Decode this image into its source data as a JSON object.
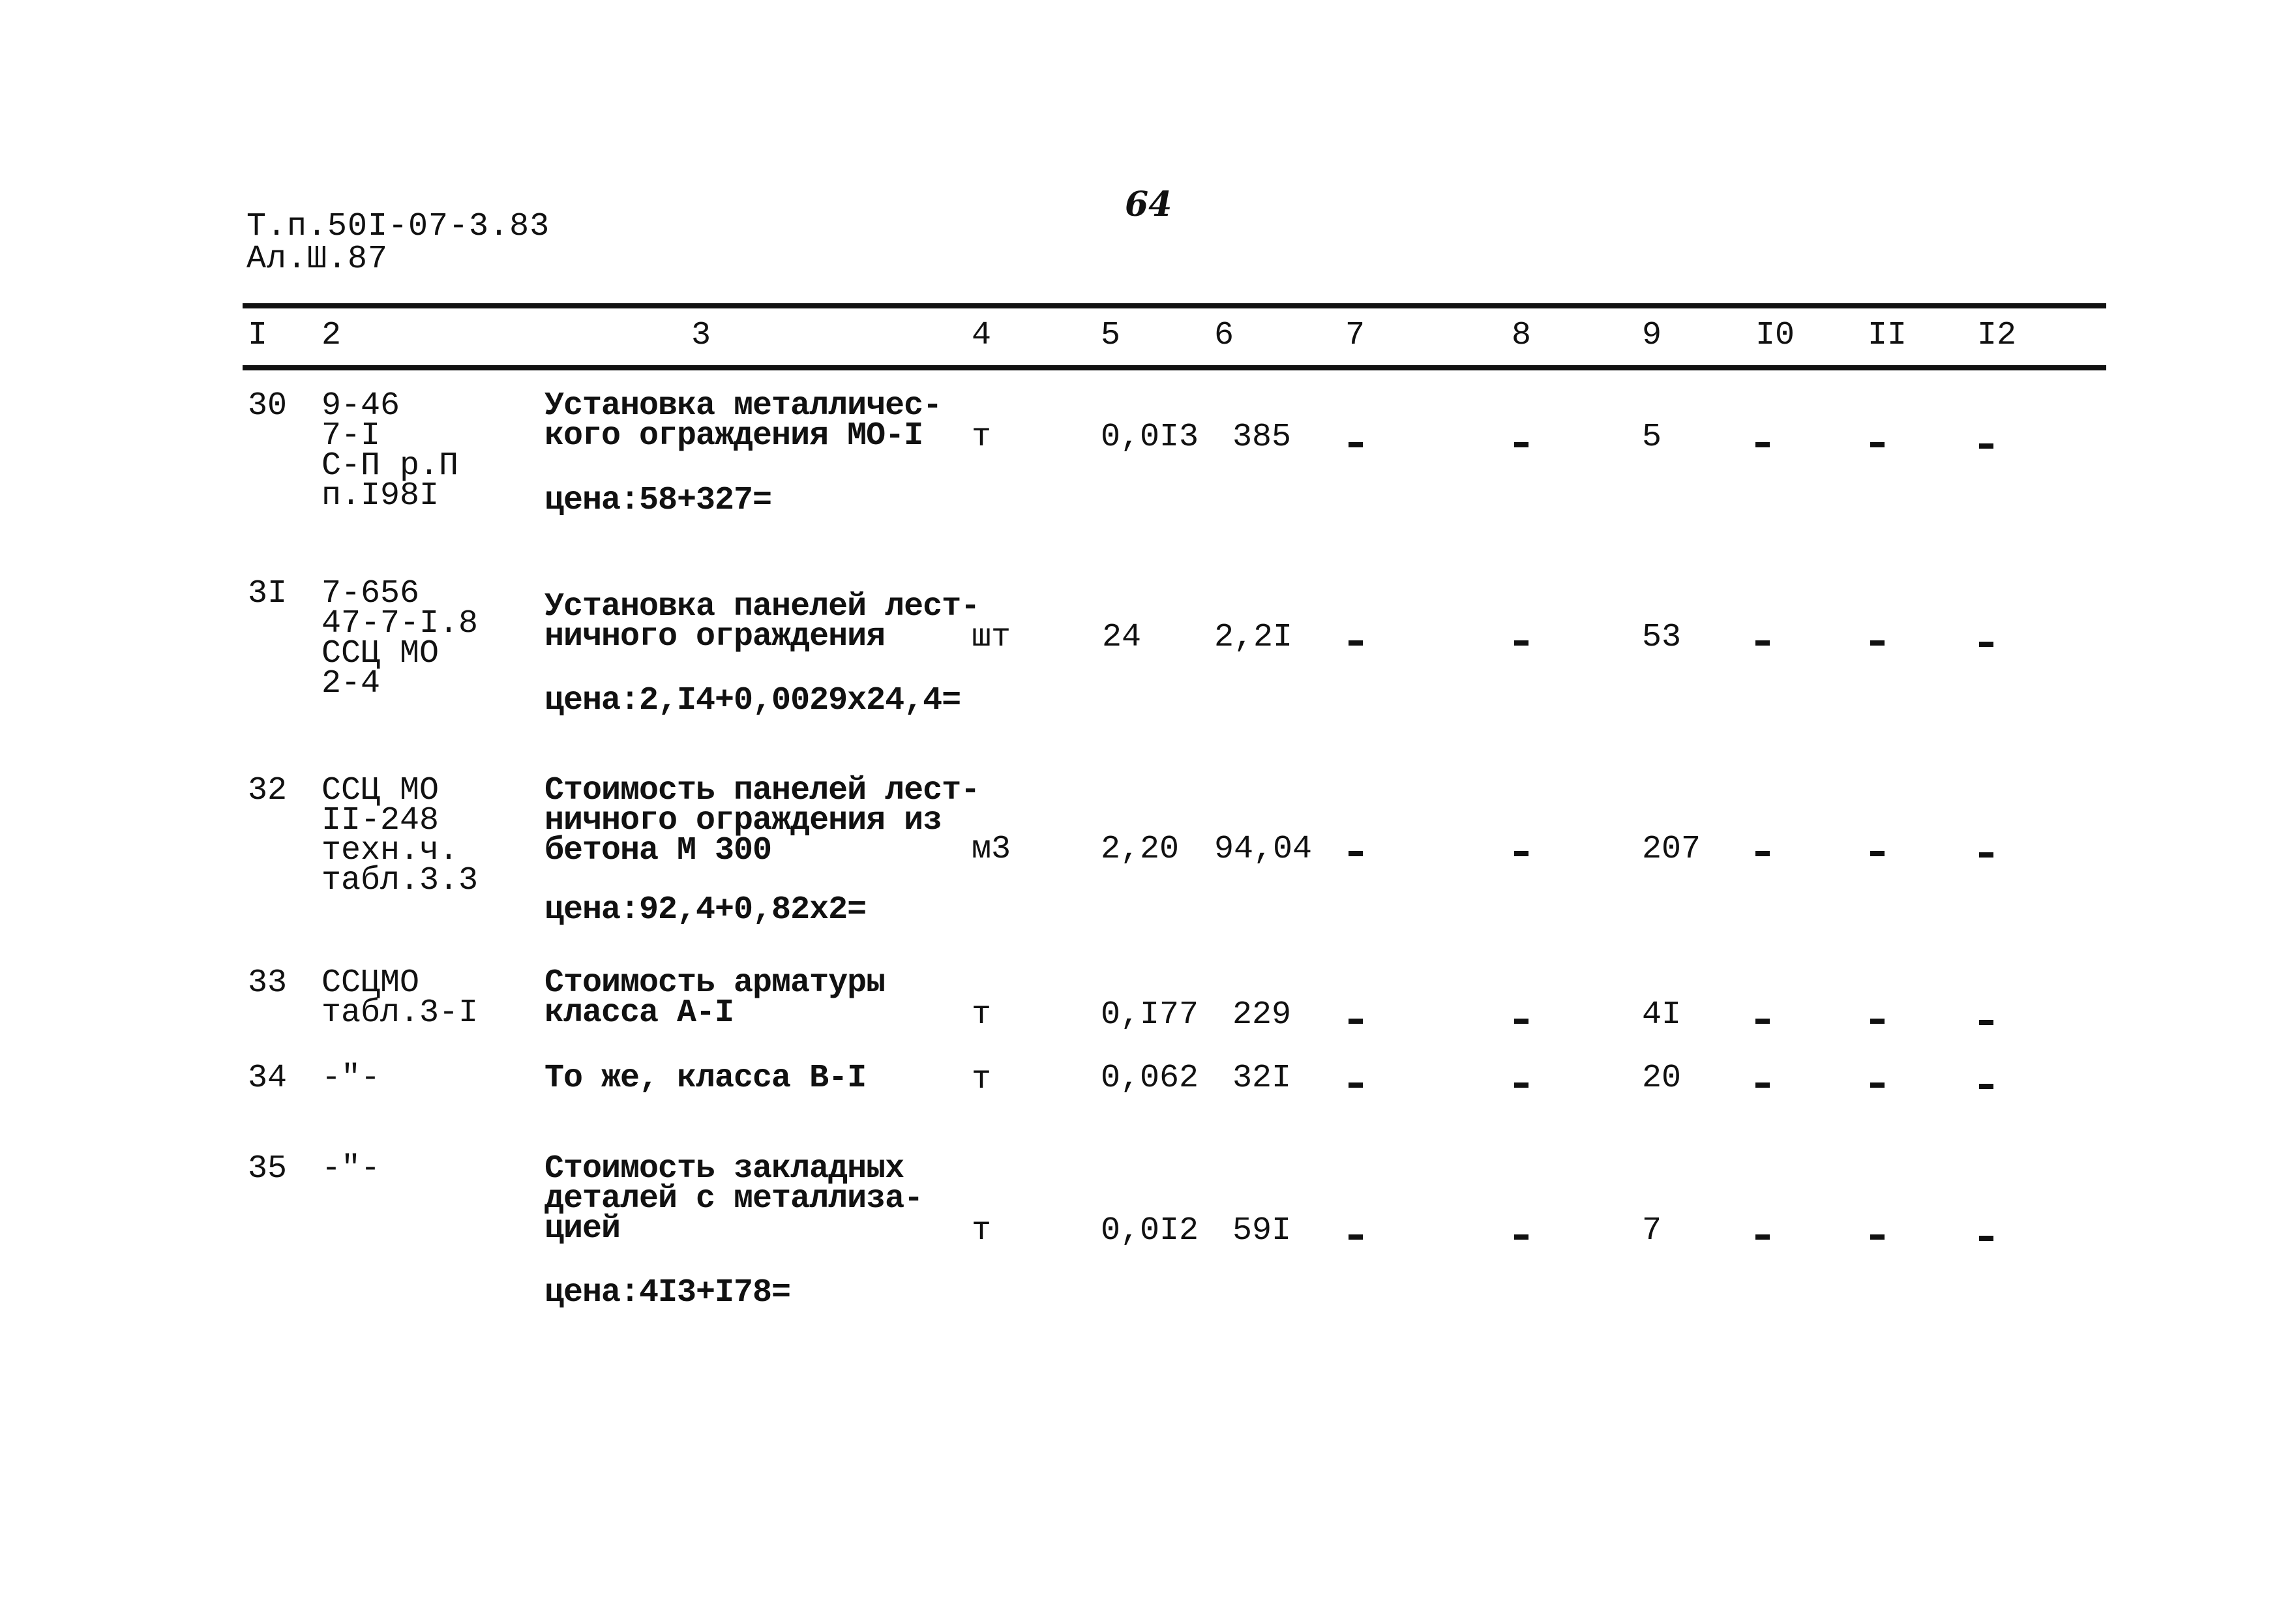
{
  "header": {
    "doc_code_line1": "Т.п.50I-07-3.83",
    "doc_code_line2": "Ал.Ш.87",
    "page_number": "64"
  },
  "table": {
    "columns": [
      "I",
      "2",
      "3",
      "4",
      "5",
      "6",
      "7",
      "8",
      "9",
      "I0",
      "II",
      "I2"
    ],
    "rows": [
      {
        "num": "30",
        "ref": "9-46\n7-I\nС-П р.П\nп.I98I",
        "desc": "Установка металличес-\nкого ограждения МО-I",
        "price": "цена:58+327=",
        "unit": "т",
        "qty": "0,0I3",
        "unit_cost": "385",
        "c7": "-",
        "c8": "-",
        "total": "5",
        "c10": "-",
        "c11": "-",
        "c12": "-"
      },
      {
        "num": "3I",
        "ref": "7-656\n47-7-I.8\nССЦ МО\n2-4",
        "desc": "Установка панелей лест-\nничного ограждения",
        "price": "цена:2,I4+0,0029х24,4=",
        "unit": "шт",
        "qty": "24",
        "unit_cost": "2,2I",
        "c7": "-",
        "c8": "-",
        "total": "53",
        "c10": "-",
        "c11": "-",
        "c12": "-"
      },
      {
        "num": "32",
        "ref": "ССЦ МО\nII-248\nтехн.ч.\nтабл.3.3",
        "desc": "Стоимость панелей лест-\nничного ограждения из\nбетона М 300",
        "price": "цена:92,4+0,82х2=",
        "unit": "м3",
        "qty": "2,20",
        "unit_cost": "94,04",
        "c7": "-",
        "c8": "-",
        "total": "207",
        "c10": "-",
        "c11": "-",
        "c12": "-"
      },
      {
        "num": "33",
        "ref": "ССЦМО\nтабл.3-I",
        "desc": "Стоимость арматуры\nкласса А-I",
        "price": "",
        "unit": "т",
        "qty": "0,I77",
        "unit_cost": "229",
        "c7": "-",
        "c8": "-",
        "total": "4I",
        "c10": "-",
        "c11": "-",
        "c12": "-"
      },
      {
        "num": "34",
        "ref": "-\"-",
        "desc": "То же, класса В-I",
        "price": "",
        "unit": "т",
        "qty": "0,062",
        "unit_cost": "32I",
        "c7": "-",
        "c8": "-",
        "total": "20",
        "c10": "-",
        "c11": "-",
        "c12": "-"
      },
      {
        "num": "35",
        "ref": "-\"-",
        "desc": "Стоимость закладных\nдеталей с металлиза-\nцией",
        "price": "цена:4I3+I78=",
        "unit": "т",
        "qty": "0,0I2",
        "unit_cost": "59I",
        "c7": "-",
        "c8": "-",
        "total": "7",
        "c10": "-",
        "c11": "-",
        "c12": "-"
      }
    ]
  }
}
